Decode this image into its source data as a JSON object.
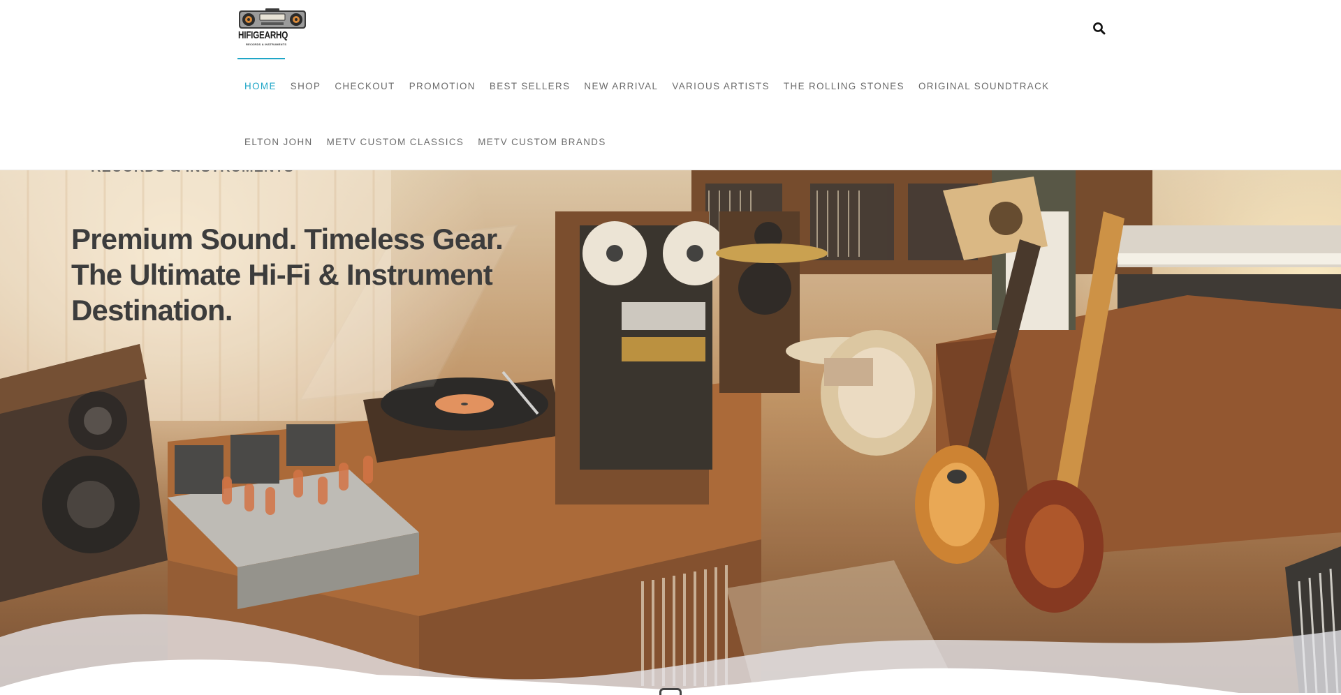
{
  "brand": {
    "name": "HIFIGEARHQ",
    "tagline": "RECORDS & INSTRUMENTS",
    "logo_icon": "boombox-logo"
  },
  "header": {
    "search_icon": "search-icon"
  },
  "nav": {
    "active_color": "#1fa6c7",
    "text_color": "#6b6b6b",
    "items": [
      {
        "label": "HOME",
        "active": true
      },
      {
        "label": "SHOP"
      },
      {
        "label": "CHECKOUT"
      },
      {
        "label": "PROMOTION"
      },
      {
        "label": "BEST SELLERS"
      },
      {
        "label": "NEW ARRIVAL"
      },
      {
        "label": "VARIOUS ARTISTS"
      },
      {
        "label": "THE ROLLING STONES"
      },
      {
        "label": "ORIGINAL SOUNDTRACK"
      },
      {
        "label": "ELTON JOHN"
      },
      {
        "label": "METV CUSTOM CLASSICS"
      },
      {
        "label": "METV CUSTOM BRANDS"
      }
    ]
  },
  "hero": {
    "faded_text": "RECORDS & INSTRUMENTS",
    "headline_lines": [
      "Premium Sound. Timeless Gear.",
      "The Ultimate Hi-Fi & Instrument",
      "Destination."
    ]
  }
}
